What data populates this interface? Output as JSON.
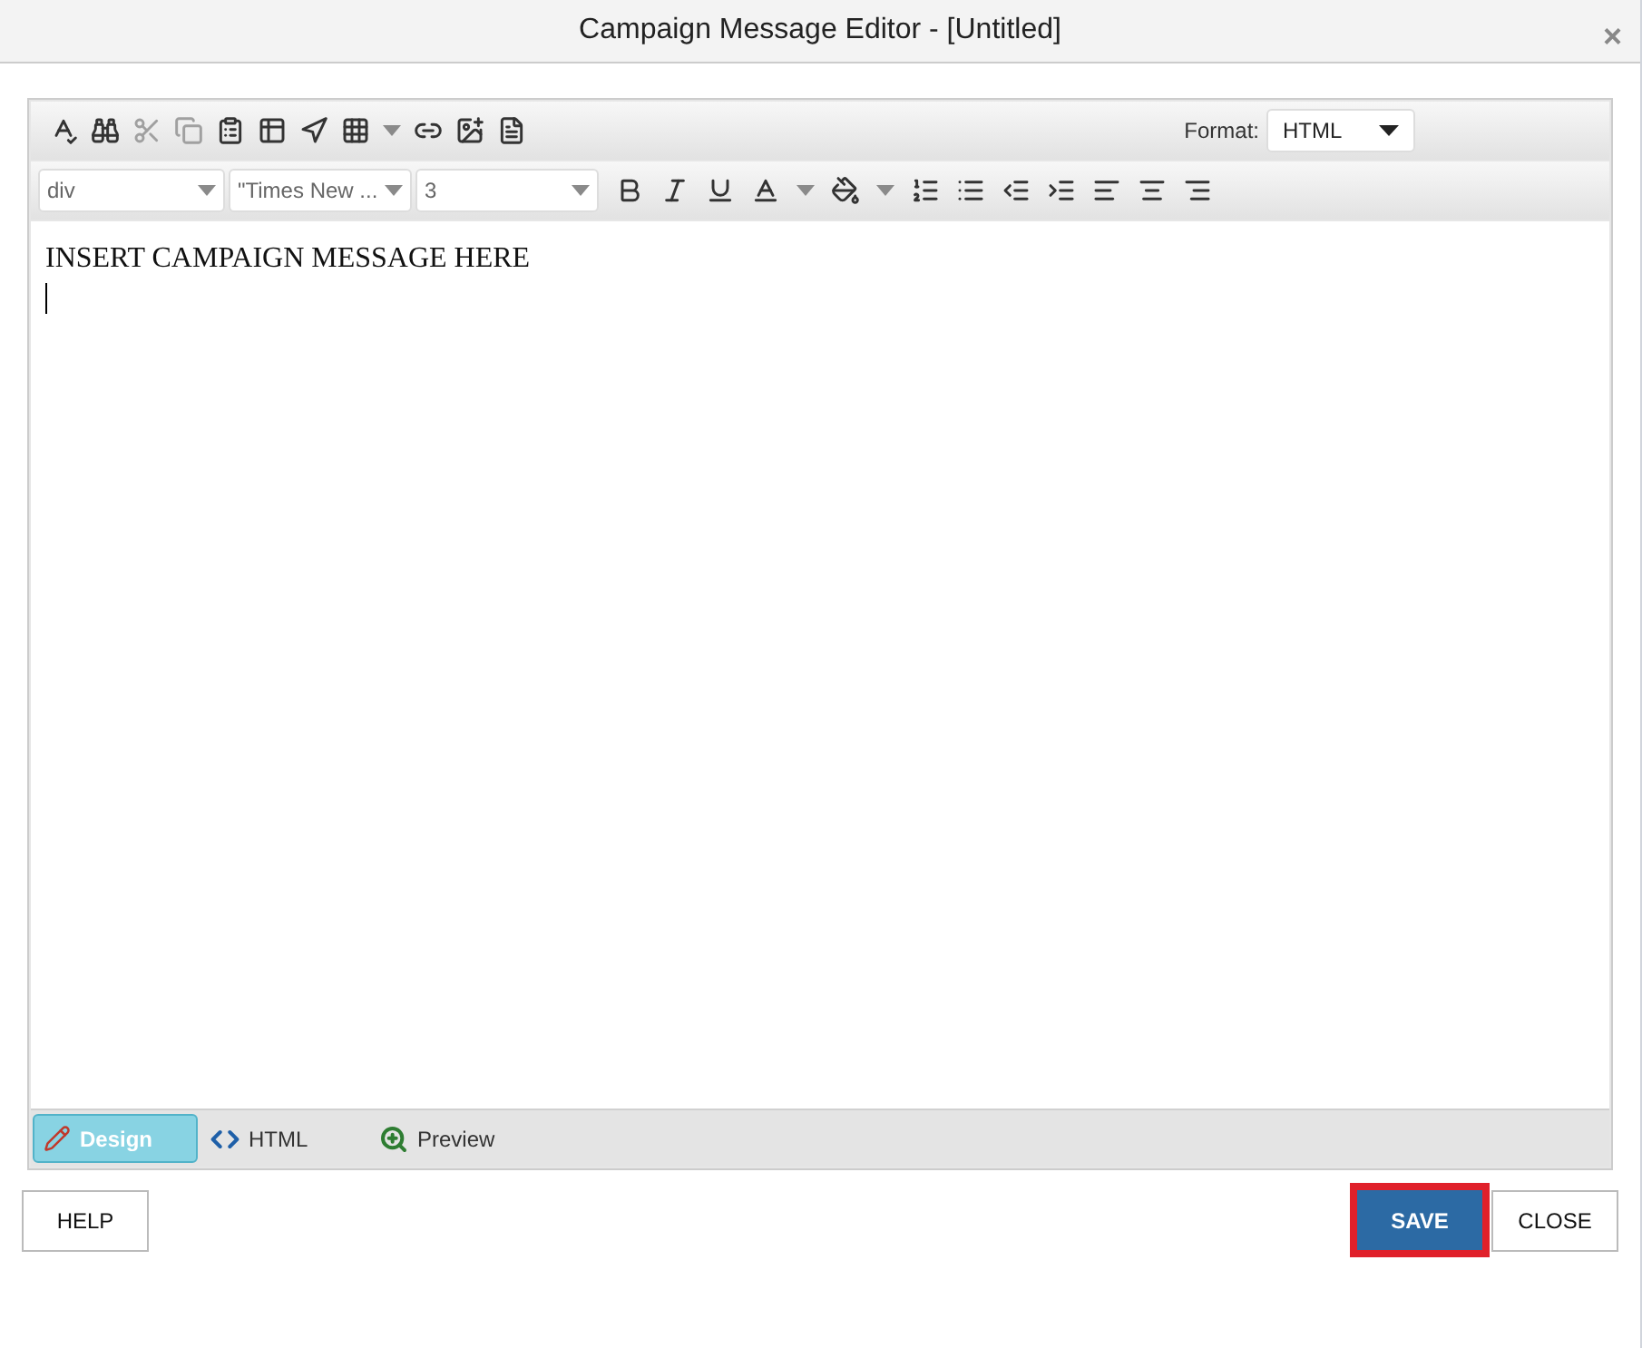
{
  "window": {
    "title": "Campaign Message Editor - [Untitled]",
    "close": "×"
  },
  "format": {
    "label": "Format:",
    "value": "HTML"
  },
  "style_selects": [
    {
      "value": "div"
    },
    {
      "value": "\"Times New ..."
    },
    {
      "value": "3"
    }
  ],
  "editor": {
    "text": "INSERT CAMPAIGN MESSAGE HERE"
  },
  "tabs": [
    {
      "label": "Design",
      "kind": "design",
      "selected": true
    },
    {
      "label": "HTML",
      "kind": "html",
      "selected": false
    },
    {
      "label": "Preview",
      "kind": "preview",
      "selected": false
    }
  ],
  "buttons": [
    {
      "label": "HELP",
      "kind": "plain"
    },
    {
      "label": "SAVE",
      "kind": "primary"
    },
    {
      "label": "CLOSE",
      "kind": "plain"
    }
  ]
}
